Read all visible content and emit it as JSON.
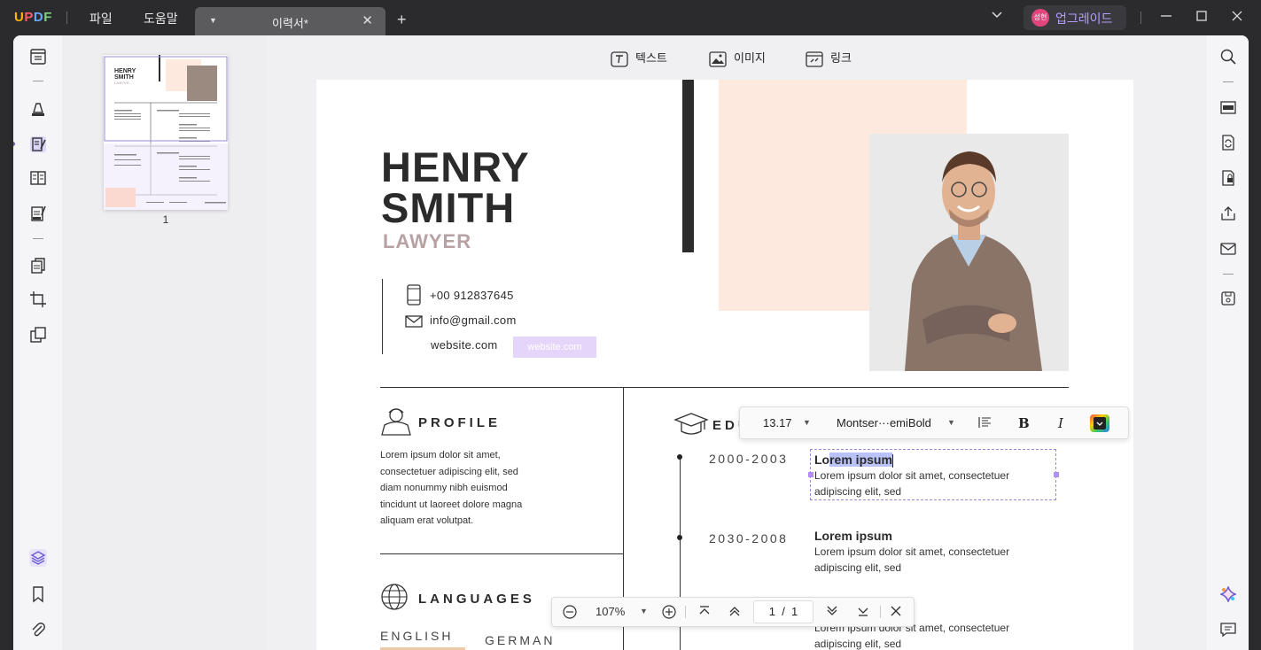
{
  "app": {
    "logo": "UPDF",
    "menu": [
      "파일",
      "도움말"
    ],
    "tab_title": "이력서*",
    "upgrade_label": "업그레이드",
    "avatar_text": "성현"
  },
  "toolbar": {
    "text_label": "텍스트",
    "image_label": "이미지",
    "link_label": "링크"
  },
  "thumbnail": {
    "page_number": "1"
  },
  "resume": {
    "first_name": "HENRY",
    "last_name": "SMITH",
    "role": "LAWYER",
    "phone": "+00 912837645",
    "email": "info@gmail.com",
    "website": "website.com",
    "website_highlight": "website.com",
    "profile_heading": "PROFILE",
    "profile_lines": [
      "Lorem ipsum dolor sit amet,",
      "consectetuer adipiscing elit, sed",
      "diam nonummy nibh euismod",
      "tincidunt ut laoreet dolore magna",
      "aliquam erat volutpat."
    ],
    "education_heading": "EDU",
    "education": [
      {
        "years": "2000-2003",
        "title_pre": "Lo",
        "title_sel": "rem ipsum",
        "desc_1": "Lorem ipsum dolor sit amet, consectetuer",
        "desc_2": "adipiscing elit, sed"
      },
      {
        "years": "2030-2008",
        "title": "Lorem ipsum",
        "desc_1": "Lorem ipsum dolor sit amet, consectetuer",
        "desc_2": "adipiscing elit, sed"
      },
      {
        "desc_1": "Lorem ipsum dolor sit amet, consectetuer",
        "desc_2": "adipiscing elit, sed"
      }
    ],
    "languages_heading": "LANGUAGES",
    "languages": [
      "ENGLISH",
      "GERMAN"
    ]
  },
  "text_format": {
    "font_size": "13.17",
    "font_name": "Montser···emiBold",
    "bold": "B",
    "italic": "I"
  },
  "page_nav": {
    "zoom": "107%",
    "page_current": "1",
    "page_sep": "/",
    "page_total": "1"
  },
  "colors": {
    "accent": "#6b5bd2",
    "peach": "#fde9de",
    "selection": "#b49cff"
  }
}
